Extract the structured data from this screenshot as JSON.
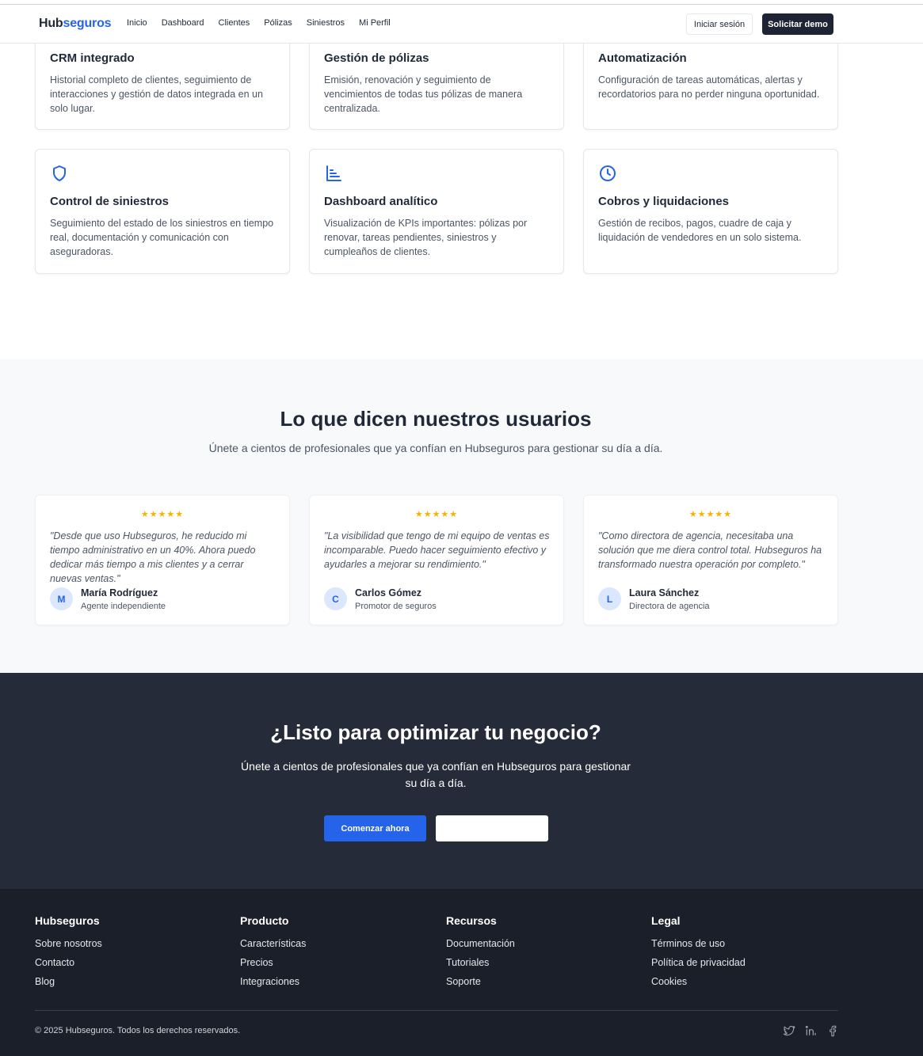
{
  "header": {
    "logo_part1": "Hub",
    "logo_part2": "seguros",
    "nav": [
      "Inicio",
      "Dashboard",
      "Clientes",
      "Pólizas",
      "Siniestros",
      "Mi Perfil"
    ],
    "login_label": "Iniciar sesión",
    "demo_label": "Solicitar demo"
  },
  "features": [
    {
      "icon": "users-icon",
      "title": "CRM integrado",
      "text": "Historial completo de clientes, seguimiento de interacciones y gestión de datos integrada en un solo lugar."
    },
    {
      "icon": "document-icon",
      "title": "Gestión de pólizas",
      "text": "Emisión, renovación y seguimiento de vencimientos de todas tus pólizas de manera centralizada."
    },
    {
      "icon": "bolt-icon",
      "title": "Automatización",
      "text": "Configuración de tareas automáticas, alertas y recordatorios para no perder ninguna oportunidad."
    },
    {
      "icon": "shield-icon",
      "title": "Control de siniestros",
      "text": "Seguimiento del estado de los siniestros en tiempo real, documentación y comunicación con aseguradoras."
    },
    {
      "icon": "bar-chart-icon",
      "title": "Dashboard analítico",
      "text": "Visualización de KPIs importantes: pólizas por renovar, tareas pendientes, siniestros y cumpleaños de clientes."
    },
    {
      "icon": "clock-icon",
      "title": "Cobros y liquidaciones",
      "text": "Gestión de recibos, pagos, cuadre de caja y liquidación de vendedores en un solo sistema."
    }
  ],
  "testimonials": {
    "title": "Lo que dicen nuestros usuarios",
    "subtitle": "Únete a cientos de profesionales que ya confían en Hubseguros para gestionar su día a día.",
    "items": [
      {
        "stars": "★★★★★",
        "rating": 5,
        "quote": "\"Desde que uso Hubseguros, he reducido mi tiempo administrativo en un 40%. Ahora puedo dedicar más tiempo a mis clientes y a cerrar nuevas ventas.\"",
        "initial": "M",
        "name": "María Rodríguez",
        "role": "Agente independiente"
      },
      {
        "stars": "★★★★★",
        "rating": 5,
        "quote": "\"La visibilidad que tengo de mi equipo de ventas es incomparable. Puedo hacer seguimiento efectivo y ayudarles a mejorar su rendimiento.\"",
        "initial": "C",
        "name": "Carlos Gómez",
        "role": "Promotor de seguros"
      },
      {
        "stars": "★★★★★",
        "rating": 5,
        "quote": "\"Como directora de agencia, necesitaba una solución que me diera control total. Hubseguros ha transformado nuestra operación por completo.\"",
        "initial": "L",
        "name": "Laura Sánchez",
        "role": "Directora de agencia"
      }
    ]
  },
  "cta": {
    "title": "¿Listo para optimizar tu negocio?",
    "subtitle": "Únete a cientos de profesionales que ya confían en Hubseguros para gestionar su día a día.",
    "start_label": "Comenzar ahora",
    "secondary_label": ""
  },
  "footer": {
    "columns": [
      {
        "title": "Hubseguros",
        "links": [
          "Sobre nosotros",
          "Contacto",
          "Blog"
        ]
      },
      {
        "title": "Producto",
        "links": [
          "Características",
          "Precios",
          "Integraciones"
        ]
      },
      {
        "title": "Recursos",
        "links": [
          "Documentación",
          "Tutoriales",
          "Soporte"
        ]
      },
      {
        "title": "Legal",
        "links": [
          "Términos de uso",
          "Política de privacidad",
          "Cookies"
        ]
      }
    ],
    "copyright": "© 2025 Hubseguros. Todos los derechos reservados.",
    "social": [
      "twitter-icon",
      "linkedin-icon",
      "facebook-icon"
    ]
  },
  "colors": {
    "brand_blue": "#2563eb",
    "dark": "#1e2433",
    "cta_bg": "#252b38",
    "footer_bg": "#1b1f29",
    "star": "#f5b301"
  }
}
